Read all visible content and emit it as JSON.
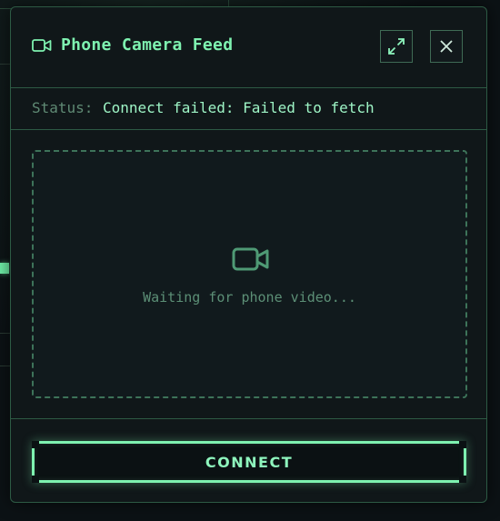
{
  "window": {
    "title": "Phone Camera Feed",
    "title_icon": "video-camera-icon",
    "expand_icon": "expand-icon",
    "close_icon": "close-icon"
  },
  "status": {
    "label": "Status:",
    "text": "Connect failed: Failed to fetch"
  },
  "video": {
    "icon": "video-camera-icon",
    "placeholder": "Waiting for phone video..."
  },
  "footer": {
    "connect_label": "CONNECT"
  },
  "colors": {
    "accent": "#7ef2b0",
    "border": "#2d5a44",
    "background": "#10171a",
    "muted_text": "#5f8a74"
  }
}
